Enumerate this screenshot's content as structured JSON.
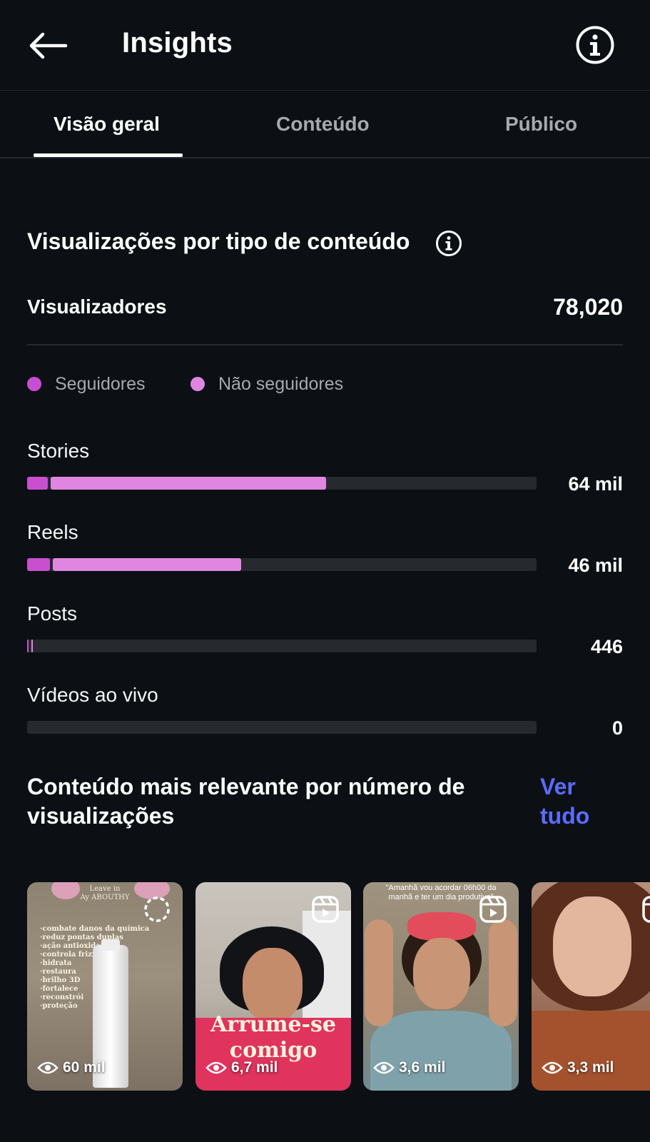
{
  "header": {
    "title": "Insights"
  },
  "tabs": [
    {
      "label": "Visão geral",
      "active": true
    },
    {
      "label": "Conteúdo",
      "active": false
    },
    {
      "label": "Público",
      "active": false
    }
  ],
  "views_section": {
    "title": "Visualizações por tipo de conteúdo",
    "viewers_label": "Visualizadores",
    "viewers_value": "78,020",
    "legend": [
      {
        "label": "Seguidores",
        "color": "#c94fd1"
      },
      {
        "label": "Não seguidores",
        "color": "#e086e0"
      }
    ],
    "bars": [
      {
        "label": "Stories",
        "value": "64 mil",
        "followers_fraction": 0.04,
        "non_followers_fraction": 0.54
      },
      {
        "label": "Reels",
        "value": "46 mil",
        "followers_fraction": 0.045,
        "non_followers_fraction": 0.37
      },
      {
        "label": "Posts",
        "value": "446",
        "followers_fraction": 0.003,
        "non_followers_fraction": 0.002
      },
      {
        "label": "Vídeos ao vivo",
        "value": "0",
        "followers_fraction": 0,
        "non_followers_fraction": 0
      }
    ]
  },
  "relevant": {
    "title": "Conteúdo mais relevante por número de visualizações",
    "see_all_label": "Ver tudo",
    "items": [
      {
        "views": "60 mil",
        "type_icon": "story-ring-icon",
        "caption_lines": [
          "Leave in",
          "Ay ABOUTHY"
        ],
        "bullets": [
          "·combate danos da química",
          "·reduz pontas duplas",
          "·ação antioxidante",
          "·controla frizz",
          "·hidrata",
          "·restaura",
          "·brilho 3D",
          "·fortalece",
          "·reconstrói",
          "·proteção"
        ]
      },
      {
        "views": "6,7 mil",
        "type_icon": "reels-icon",
        "overlay": "Arrume-se comigo"
      },
      {
        "views": "3,6 mil",
        "type_icon": "reels-icon",
        "top_caption": "\"Amanhã vou acordar 06h00 da manhã e ter um dia produtivo\""
      },
      {
        "views": "3,3 mil",
        "type_icon": "reels-icon"
      }
    ]
  },
  "colors": {
    "background": "#0c1014",
    "followers": "#c94fd1",
    "non_followers": "#e086e0",
    "track": "#262a2f",
    "link": "#5b6cff"
  }
}
